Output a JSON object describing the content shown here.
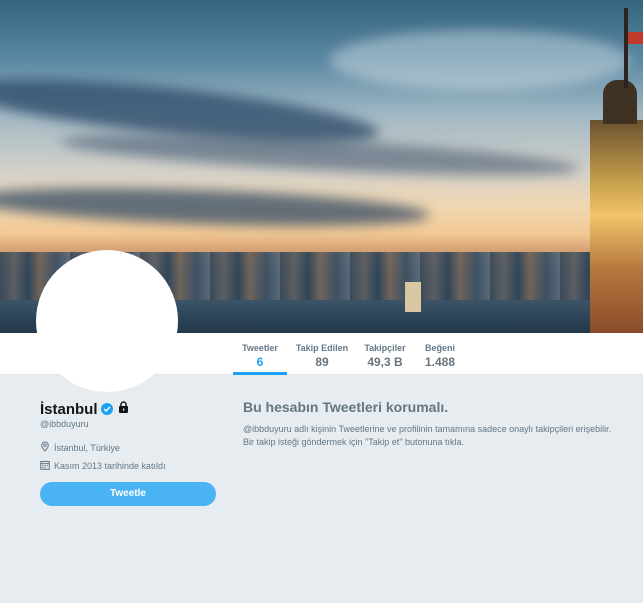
{
  "profile": {
    "name": "İstanbul",
    "handle": "@ibbduyuru",
    "location": "İstanbul, Türkiye",
    "joined": "Kasım 2013 tarihinde katıldı",
    "tweet_button": "Tweetle"
  },
  "stats": [
    {
      "label": "Tweetler",
      "value": "6",
      "active": true
    },
    {
      "label": "Takip Edilen",
      "value": "89",
      "active": false
    },
    {
      "label": "Takipçiler",
      "value": "49,3 B",
      "active": false
    },
    {
      "label": "Beğeni",
      "value": "1.488",
      "active": false
    }
  ],
  "protected": {
    "title": "Bu hesabın Tweetleri korumalı.",
    "body_line1": "@ibbduyuru adlı kişinin Tweetlerine ve profilinin tamamına sadece onaylı takipçileri erişebilir.",
    "body_line2": "Bir takip isteği göndermek için \"Takip et\" butonuna tıkla."
  },
  "colors": {
    "accent": "#1da1f2",
    "button": "#4ab3f4",
    "background": "#e6ecf0"
  },
  "icons": [
    "verified-icon",
    "lock-icon",
    "location-pin-icon",
    "calendar-icon"
  ]
}
